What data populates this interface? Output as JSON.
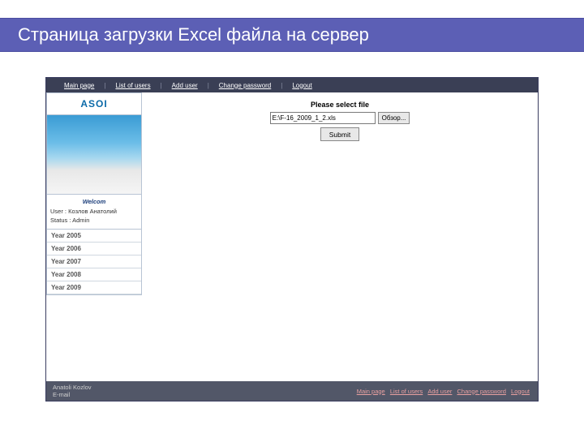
{
  "slide": {
    "title": "Страница загрузки Excel файла на сервер"
  },
  "topnav": {
    "items": [
      {
        "label": "Main page"
      },
      {
        "label": "List of users"
      },
      {
        "label": "Add user"
      },
      {
        "label": "Change password"
      },
      {
        "label": "Logout"
      }
    ]
  },
  "sidebar": {
    "logo": "ASOI",
    "welcome": {
      "title": "Welcom",
      "user_label": "User :",
      "user_value": "Козлов Анатолий",
      "status_label": "Status :",
      "status_value": "Admin"
    },
    "years": [
      {
        "label": "Year 2005"
      },
      {
        "label": "Year 2006"
      },
      {
        "label": "Year 2007"
      },
      {
        "label": "Year 2008"
      },
      {
        "label": "Year 2009"
      }
    ]
  },
  "main": {
    "prompt": "Please select file",
    "file_value": "E:\\F-16_2009_1_2.xls",
    "browse_label": "Обзор...",
    "submit_label": "Submit"
  },
  "footer": {
    "author": "Anatoli Kozlov",
    "email_label": "E-mail",
    "links": [
      {
        "label": "Main page"
      },
      {
        "label": "List of users"
      },
      {
        "label": "Add user"
      },
      {
        "label": "Change password"
      },
      {
        "label": "Logout"
      }
    ]
  }
}
